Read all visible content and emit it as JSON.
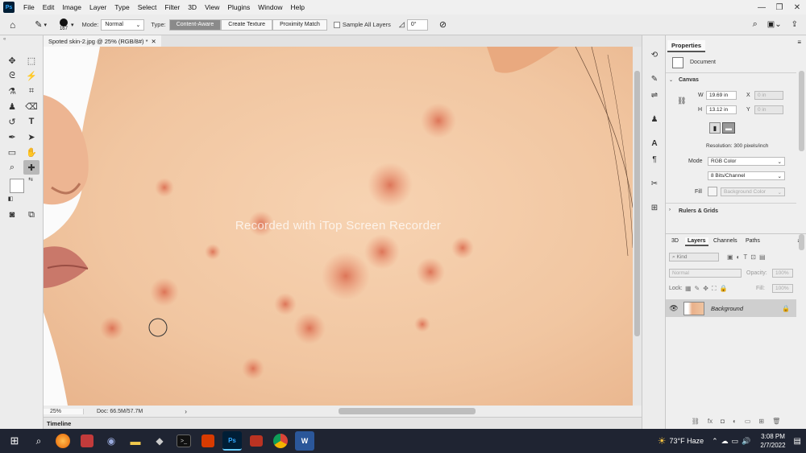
{
  "app": {
    "logo": "Ps"
  },
  "menu": [
    "File",
    "Edit",
    "Image",
    "Layer",
    "Type",
    "Select",
    "Filter",
    "3D",
    "View",
    "Plugins",
    "Window",
    "Help"
  ],
  "options": {
    "brush_size": "167",
    "mode_label": "Mode:",
    "mode_value": "Normal",
    "type_label": "Type:",
    "type_buttons": [
      "Content-Aware",
      "Create Texture",
      "Proximity Match"
    ],
    "sample_all_layers": "Sample All Layers",
    "angle": "0°"
  },
  "document": {
    "tab_title": "Spoted skin-2.jpg @ 25% (RGB/8#) *",
    "watermark": "Recorded with iTop Screen Recorder",
    "zoom": "25%",
    "doc_size": "Doc: 66.5M/57.7M"
  },
  "timeline": {
    "label": "Timeline"
  },
  "properties": {
    "tab": "Properties",
    "doc_label": "Document",
    "canvas_header": "Canvas",
    "w_label": "W",
    "w_value": "19.69 in",
    "h_label": "H",
    "h_value": "13.12 in",
    "x_label": "X",
    "x_value": "0 in",
    "y_label": "Y",
    "y_value": "0 in",
    "resolution": "Resolution: 300 pixels/inch",
    "mode_label": "Mode",
    "mode_value": "RGB Color",
    "bits_value": "8 Bits/Channel",
    "fill_label": "Fill",
    "fill_value": "Background Color",
    "rulers_header": "Rulers & Grids"
  },
  "layers": {
    "tabs": [
      "3D",
      "Layers",
      "Channels",
      "Paths"
    ],
    "kind": "Kind",
    "blend": "Normal",
    "opacity_label": "Opacity:",
    "opacity_value": "100%",
    "lock_label": "Lock:",
    "fill_label": "Fill:",
    "fill_value": "100%",
    "layer_name": "Background"
  },
  "taskbar": {
    "weather": "73°F  Haze",
    "time": "3:08 PM",
    "date": "2/7/2022"
  },
  "colors": {
    "accent": "#31a8ff",
    "taskbar": "#1f2432",
    "skin": "#f0c9a6"
  }
}
